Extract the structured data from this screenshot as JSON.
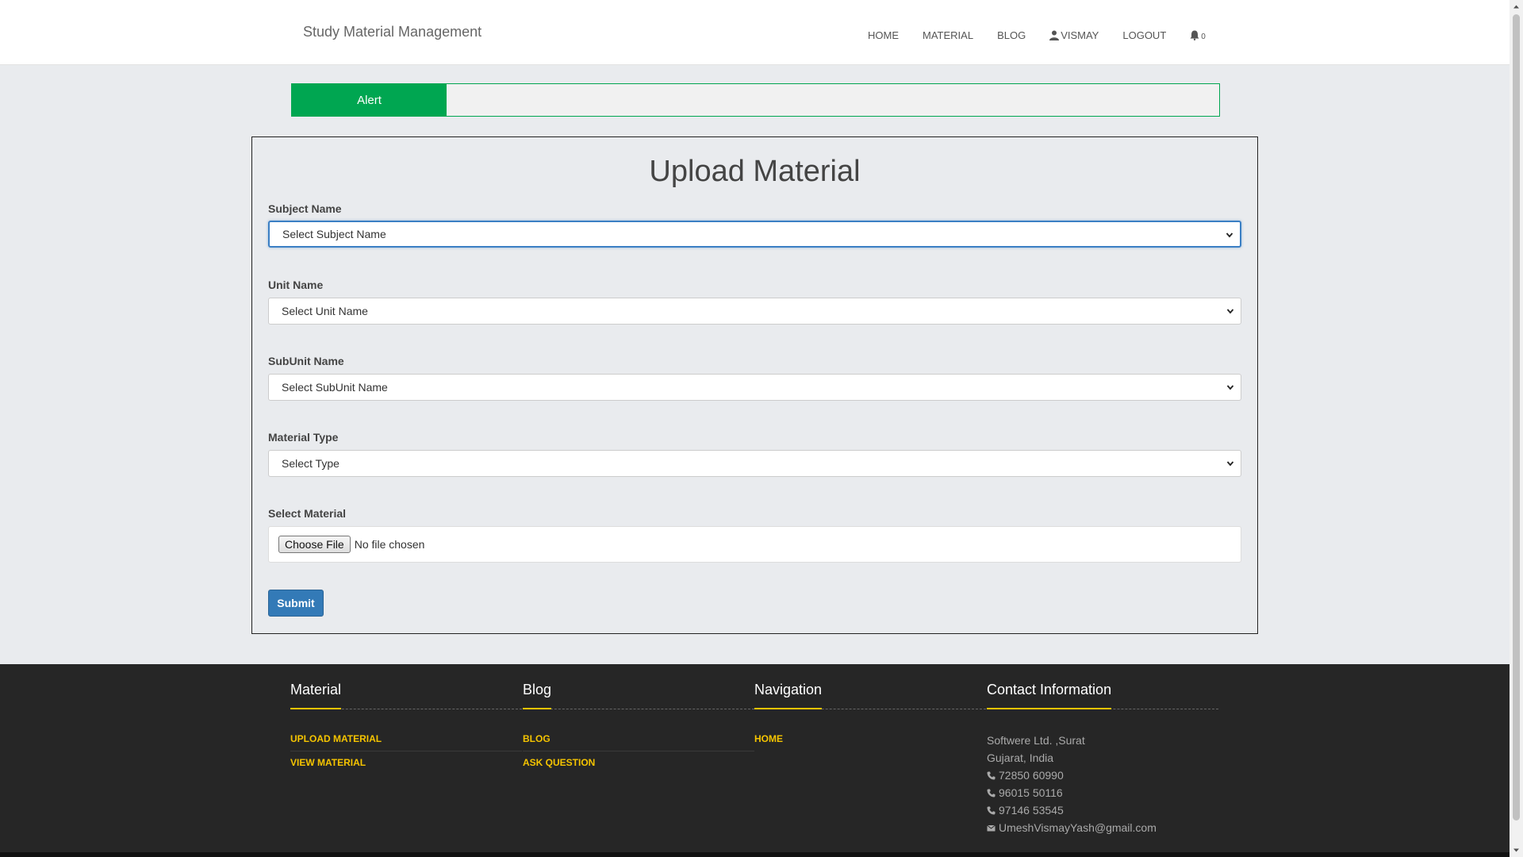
{
  "navbar": {
    "brand": "Study Material Management",
    "links": [
      "HOME",
      "MATERIAL",
      "BLOG",
      "VISMAY",
      "LOGOUT"
    ],
    "notification_count": "0"
  },
  "alert": {
    "label": "Alert",
    "message": ""
  },
  "form": {
    "title": "Upload Material",
    "subject": {
      "label": "Subject Name",
      "value": "Select Subject Name"
    },
    "unit": {
      "label": "Unit Name",
      "value": "Select Unit Name"
    },
    "subunit": {
      "label": "SubUnit Name",
      "value": "Select SubUnit Name"
    },
    "type": {
      "label": "Material Type",
      "value": "Select Type"
    },
    "material": {
      "label": "Select Material",
      "button": "Choose File",
      "status": "No file chosen"
    },
    "submit": "Submit"
  },
  "footer": {
    "material": {
      "title": "Material",
      "links": [
        "UPLOAD MATERIAL",
        "VIEW MATERIAL"
      ]
    },
    "blog": {
      "title": "Blog",
      "links": [
        "BLOG",
        "ASK QUESTION"
      ]
    },
    "navigation": {
      "title": "Navigation",
      "links": [
        "HOME"
      ]
    },
    "contact": {
      "title": "Contact Information",
      "address1": "Softwere Ltd. ,Surat",
      "address2": "Gujarat, India",
      "phones": [
        "72850 60990",
        "96015 50116",
        "97146 53545"
      ],
      "email": "UmeshVismayYash@gmail.com"
    }
  },
  "colors": {
    "accent_green": "#00a651",
    "button_blue": "#337ab7",
    "footer_bg": "#262626",
    "footer_link": "#f5c400"
  }
}
